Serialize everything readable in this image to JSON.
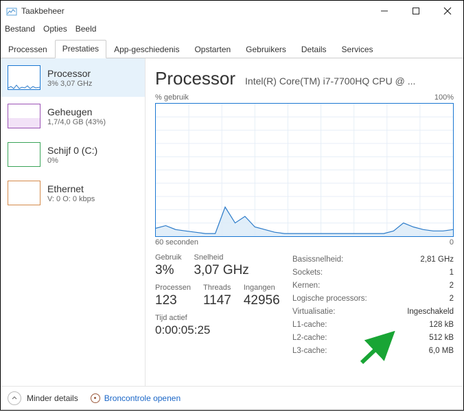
{
  "window": {
    "title": "Taakbeheer"
  },
  "menu": {
    "file": "Bestand",
    "options": "Opties",
    "view": "Beeld"
  },
  "tabs": [
    {
      "label": "Processen"
    },
    {
      "label": "Prestaties"
    },
    {
      "label": "App-geschiedenis"
    },
    {
      "label": "Opstarten"
    },
    {
      "label": "Gebruikers"
    },
    {
      "label": "Details"
    },
    {
      "label": "Services"
    }
  ],
  "sidebar": {
    "items": [
      {
        "title": "Processor",
        "sub": "3%  3,07 GHz",
        "color": "blue"
      },
      {
        "title": "Geheugen",
        "sub": "1,7/4,0 GB (43%)",
        "color": "purple"
      },
      {
        "title": "Schijf 0 (C:)",
        "sub": "0%",
        "color": "green"
      },
      {
        "title": "Ethernet",
        "sub": "V: 0  O: 0 kbps",
        "color": "orange"
      }
    ]
  },
  "main": {
    "title": "Processor",
    "subtitle": "Intel(R) Core(TM) i7-7700HQ CPU @ ...",
    "chart_top_left": "% gebruik",
    "chart_top_right": "100%",
    "chart_bottom_left": "60 seconden",
    "chart_bottom_right": "0",
    "metrics": {
      "usage_label": "Gebruik",
      "usage_value": "3%",
      "speed_label": "Snelheid",
      "speed_value": "3,07 GHz",
      "proc_label": "Processen",
      "proc_value": "123",
      "thread_label": "Threads",
      "thread_value": "1147",
      "handles_label": "Ingangen",
      "handles_value": "42956",
      "uptime_label": "Tijd actief",
      "uptime_value": "0:00:05:25"
    },
    "details": {
      "base_k": "Basissnelheid:",
      "base_v": "2,81 GHz",
      "sockets_k": "Sockets:",
      "sockets_v": "1",
      "cores_k": "Kernen:",
      "cores_v": "2",
      "logical_k": "Logische processors:",
      "logical_v": "2",
      "virt_k": "Virtualisatie:",
      "virt_v": "Ingeschakeld",
      "l1_k": "L1-cache:",
      "l1_v": "128 kB",
      "l2_k": "L2-cache:",
      "l2_v": "512 kB",
      "l3_k": "L3-cache:",
      "l3_v": "6,0 MB"
    }
  },
  "footer": {
    "less": "Minder details",
    "resmon": "Broncontrole openen"
  },
  "chart_data": {
    "type": "area",
    "title": "% gebruik",
    "xlabel": "60 seconden",
    "ylabel": "",
    "ylim": [
      0,
      100
    ],
    "xlim": [
      60,
      0
    ],
    "x": [
      60,
      58,
      56,
      54,
      52,
      50,
      48,
      46,
      44,
      42,
      40,
      38,
      36,
      34,
      32,
      30,
      28,
      26,
      24,
      22,
      20,
      18,
      16,
      14,
      12,
      10,
      8,
      6,
      4,
      2,
      0
    ],
    "values": [
      6,
      8,
      5,
      4,
      3,
      2,
      2,
      22,
      10,
      15,
      7,
      5,
      3,
      2,
      2,
      2,
      2,
      2,
      2,
      2,
      2,
      2,
      2,
      2,
      4,
      10,
      7,
      5,
      4,
      4,
      5
    ]
  }
}
